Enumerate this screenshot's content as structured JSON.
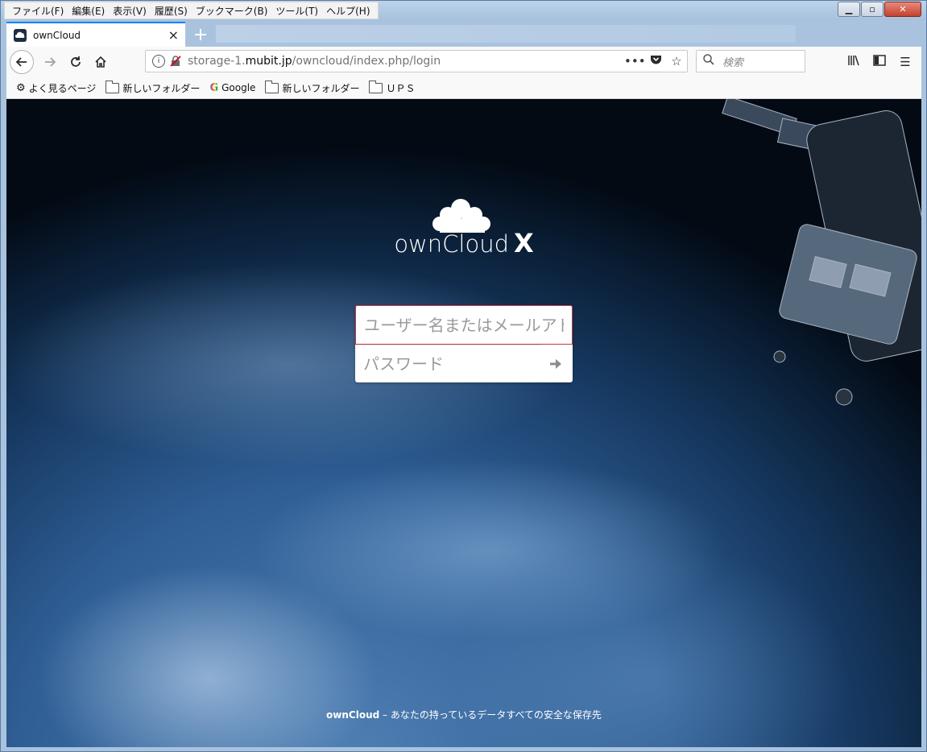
{
  "menubar": {
    "items": [
      "ファイル(F)",
      "編集(E)",
      "表示(V)",
      "履歴(S)",
      "ブックマーク(B)",
      "ツール(T)",
      "ヘルプ(H)"
    ]
  },
  "tab": {
    "title": "ownCloud"
  },
  "navbar": {
    "url_host_prefix": "storage-1.",
    "url_host_domain": "mubit.jp",
    "url_path": "/owncloud/index.php/login",
    "search_placeholder": "検索"
  },
  "bookmarks": {
    "items": [
      "よく見るページ",
      "新しいフォルダー",
      "Google",
      "新しいフォルダー",
      "ＵＰＳ"
    ]
  },
  "login": {
    "logo_text": "ownCloud",
    "logo_suffix": "X",
    "username_placeholder": "ユーザー名またはメールアドレス",
    "password_placeholder": "パスワード"
  },
  "footer": {
    "brand": "ownCloud",
    "tagline": " – あなたの持っているデータすべての安全な保存先"
  },
  "colors": {
    "tab_accent": "#0a84ff",
    "input_focus_border": "#c33342",
    "close_button": "#c4412d"
  }
}
